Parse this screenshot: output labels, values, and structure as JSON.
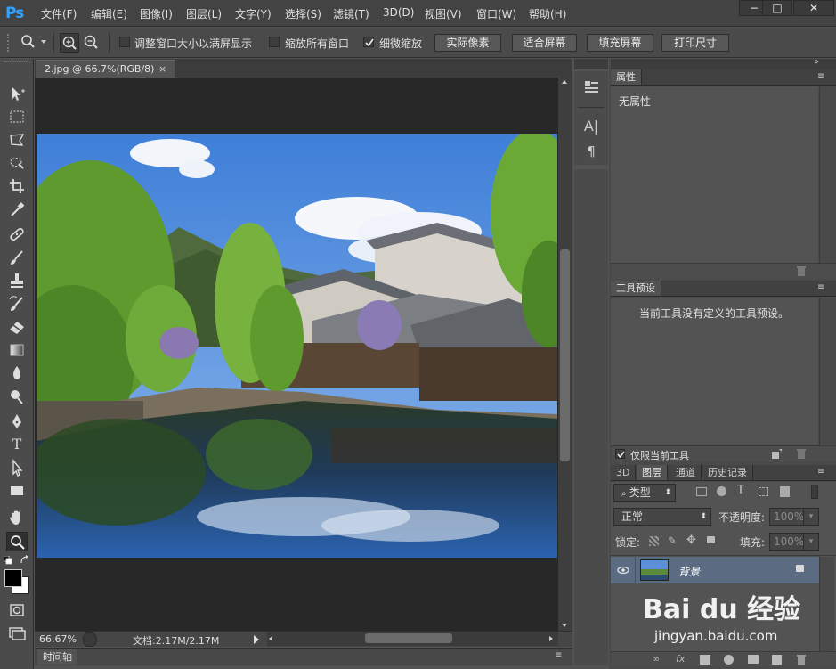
{
  "app": {
    "logo": "Ps"
  },
  "menu": [
    "文件(F)",
    "编辑(E)",
    "图像(I)",
    "图层(L)",
    "文字(Y)",
    "选择(S)",
    "滤镜(T)",
    "3D(D)",
    "视图(V)",
    "窗口(W)",
    "帮助(H)"
  ],
  "window_controls": {
    "minimize": "−",
    "maximize": "□",
    "close": "✕"
  },
  "options": {
    "resize_windows": "调整窗口大小以满屏显示",
    "zoom_all": "缩放所有窗口",
    "scrubby_zoom": "细微缩放",
    "scrubby_checked": true,
    "buttons": [
      "实际像素",
      "适合屏幕",
      "填充屏幕",
      "打印尺寸"
    ]
  },
  "document": {
    "tab_title": "2.jpg @ 66.7%(RGB/8)",
    "tab_close": "×",
    "zoom": "66.67%",
    "doc_info": "文档:2.17M/2.17M"
  },
  "timeline": {
    "label": "时间轴"
  },
  "properties_panel": {
    "title": "属性",
    "empty_text": "无属性"
  },
  "tool_presets_panel": {
    "title": "工具预设",
    "message": "当前工具没有定义的工具预设。",
    "current_only": "仅限当前工具",
    "current_only_checked": true
  },
  "layers_panel": {
    "tabs": [
      "3D",
      "图层",
      "通道",
      "历史记录"
    ],
    "active_tab": "图层",
    "filter_label": "类型",
    "blend_mode": "正常",
    "opacity_label": "不透明度:",
    "opacity_value": "100%",
    "lock_label": "锁定:",
    "fill_label": "填充:",
    "fill_value": "100%",
    "layers": [
      {
        "name": "背景",
        "visible": true,
        "locked": true
      }
    ]
  },
  "watermark": {
    "brand": "Bai du 经验",
    "url": "jingyan.baidu.com"
  },
  "colors": {
    "bg": "#535353",
    "dark": "#282828",
    "accent": "#32a0ff",
    "selected_layer": "#5a6b82"
  }
}
